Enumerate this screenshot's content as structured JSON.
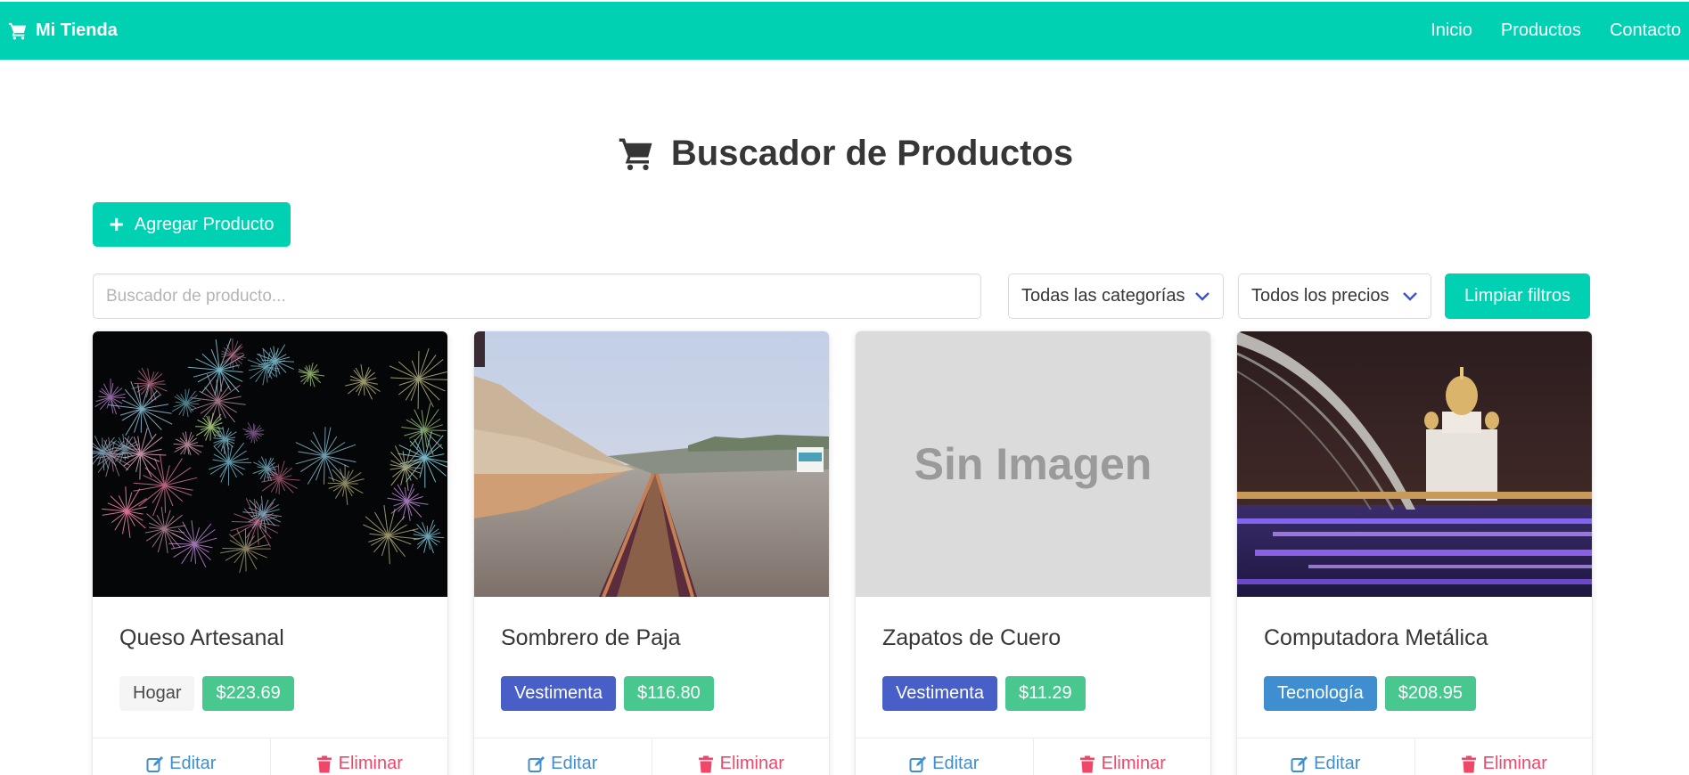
{
  "navbar": {
    "brand": "Mi Tienda",
    "brand_icon": "cart-icon",
    "links": [
      "Inicio",
      "Productos",
      "Contacto"
    ],
    "color": "#00d1b2"
  },
  "page": {
    "title": "Buscador de Productos",
    "title_icon": "cart-icon"
  },
  "toolbar": {
    "add_label": "Agregar Producto",
    "search_placeholder": "Buscador de producto...",
    "search_value": "",
    "category_select": "Todas las categorías",
    "price_select": "Todos los precios",
    "clear_label": "Limpiar filtros"
  },
  "products": [
    {
      "name": "Queso Artesanal",
      "category": "Hogar",
      "price": "$223.69",
      "image": "fireworks",
      "edit": "Editar",
      "delete": "Eliminar"
    },
    {
      "name": "Sombrero de Paja",
      "category": "Vestimenta",
      "price": "$116.80",
      "image": "railroad-tracks",
      "edit": "Editar",
      "delete": "Eliminar"
    },
    {
      "name": "Zapatos de Cuero",
      "category": "Vestimenta",
      "price": "$11.29",
      "image": "none",
      "no_image_label": "Sin Imagen",
      "edit": "Editar",
      "delete": "Eliminar"
    },
    {
      "name": "Computadora Metálica",
      "category": "Tecnología",
      "price": "$208.95",
      "image": "night-bridge-cathedral",
      "edit": "Editar",
      "delete": "Eliminar"
    }
  ]
}
